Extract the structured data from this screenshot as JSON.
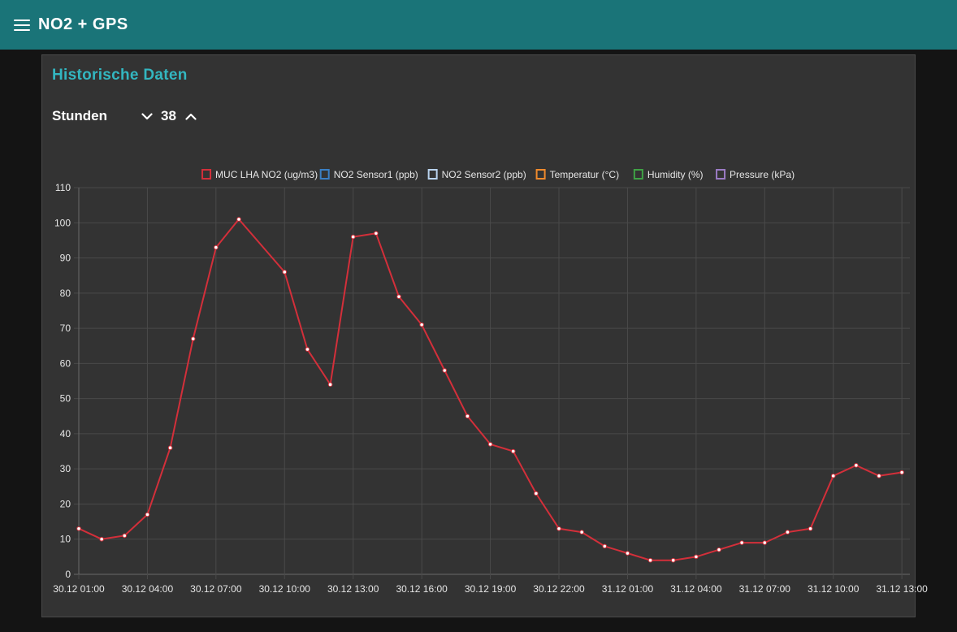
{
  "header": {
    "title": "NO2 + GPS",
    "menu_icon": "hamburger-icon"
  },
  "panel": {
    "title": "Historische Daten",
    "hours_label": "Stunden",
    "hours_value": "38",
    "decrement_icon": "chevron-down-icon",
    "increment_icon": "chevron-up-icon"
  },
  "colors": {
    "header_bg": "#1a7478",
    "panel_title": "#33b6c0",
    "series_line": "#d32f3a"
  },
  "chart_data": {
    "type": "line",
    "x": [
      "30.12 01:00",
      "30.12 02:00",
      "30.12 03:00",
      "30.12 04:00",
      "30.12 05:00",
      "30.12 06:00",
      "30.12 07:00",
      "30.12 08:00",
      "30.12 09:00",
      "30.12 10:00",
      "30.12 11:00",
      "30.12 12:00",
      "30.12 13:00",
      "30.12 14:00",
      "30.12 15:00",
      "30.12 16:00",
      "30.12 17:00",
      "30.12 18:00",
      "30.12 19:00",
      "30.12 20:00",
      "30.12 21:00",
      "30.12 22:00",
      "30.12 23:00",
      "31.12 00:00",
      "31.12 01:00",
      "31.12 02:00",
      "31.12 03:00",
      "31.12 04:00",
      "31.12 05:00",
      "31.12 06:00",
      "31.12 07:00",
      "31.12 08:00",
      "31.12 09:00",
      "31.12 10:00",
      "31.12 11:00",
      "31.12 12:00",
      "31.12 13:00"
    ],
    "x_tick_labels": [
      "30.12 01:00",
      "30.12 04:00",
      "30.12 07:00",
      "30.12 10:00",
      "30.12 13:00",
      "30.12 16:00",
      "30.12 19:00",
      "30.12 22:00",
      "31.12 01:00",
      "31.12 04:00",
      "31.12 07:00",
      "31.12 10:00",
      "31.12 13:00"
    ],
    "y_ticks": [
      0,
      10,
      20,
      30,
      40,
      50,
      60,
      70,
      80,
      90,
      100,
      110
    ],
    "ylim": [
      0,
      110
    ],
    "grid": true,
    "legend_position": "top-center",
    "legend": [
      {
        "name": "MUC LHA NO2 (ug/m3)",
        "color": "#d32f3a"
      },
      {
        "name": "NO2 Sensor1 (ppb)",
        "color": "#3a7fc4"
      },
      {
        "name": "NO2 Sensor2 (ppb)",
        "color": "#b9d3ee"
      },
      {
        "name": "Temperatur (°C)",
        "color": "#f08a2c"
      },
      {
        "name": "Humidity (%)",
        "color": "#3fa245"
      },
      {
        "name": "Pressure (kPa)",
        "color": "#9b7bc5"
      }
    ],
    "series": [
      {
        "name": "MUC LHA NO2 (ug/m3)",
        "color": "#d32f3a",
        "values": [
          13,
          10,
          11,
          17,
          36,
          67,
          93,
          101,
          null,
          86,
          64,
          54,
          96,
          97,
          79,
          71,
          58,
          45,
          37,
          35,
          23,
          13,
          12,
          8,
          6,
          4,
          4,
          5,
          7,
          9,
          9,
          12,
          13,
          28,
          31,
          28,
          29
        ]
      }
    ],
    "xlabel": "",
    "ylabel": "",
    "title": ""
  }
}
